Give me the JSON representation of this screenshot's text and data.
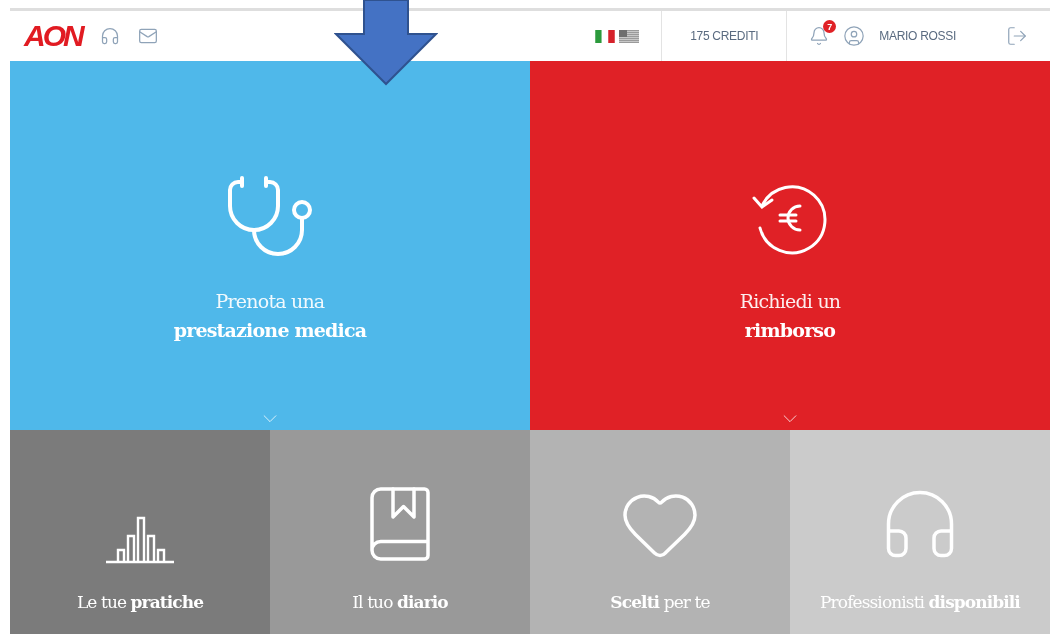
{
  "header": {
    "logo": "AON",
    "credits": "175 CREDITI",
    "notification_count": "7",
    "user_name": "MARIO ROSSI"
  },
  "main_tiles": [
    {
      "kind": "stethoscope",
      "line1": "Prenota una",
      "line2": "prestazione medica",
      "color": "#4fb8ea"
    },
    {
      "kind": "refund",
      "line1": "Richiedi un",
      "line2": "rimborso",
      "color": "#e02126"
    }
  ],
  "shortcut_tiles": [
    {
      "kind": "chart",
      "label": "Le tue **pratiche**",
      "color": "#7b7b7b"
    },
    {
      "kind": "book",
      "label": "Il tuo **diario**",
      "color": "#999999"
    },
    {
      "kind": "heart",
      "label": "**Scelti** per te",
      "color": "#b3b3b3"
    },
    {
      "kind": "headset",
      "label": "Professionisti **disponibili**",
      "color": "#cbcbcb"
    }
  ]
}
